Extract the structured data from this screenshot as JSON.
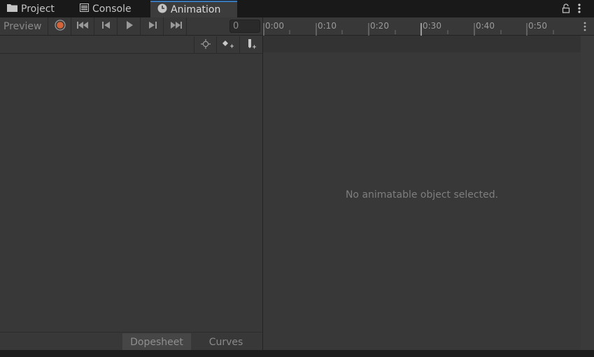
{
  "tabs": [
    {
      "label": "Project",
      "icon": "folder-icon"
    },
    {
      "label": "Console",
      "icon": "console-icon"
    },
    {
      "label": "Animation",
      "icon": "clock-icon"
    }
  ],
  "toolbar": {
    "preview_label": "Preview",
    "frame_value": "0"
  },
  "timeline": {
    "ticks": [
      "0:00",
      "0:10",
      "0:20",
      "0:30",
      "0:40",
      "0:50"
    ]
  },
  "views": {
    "dopesheet_label": "Dopesheet",
    "curves_label": "Curves"
  },
  "message": "No animatable object selected.",
  "colors": {
    "accent": "#3a79bb",
    "record": "#d4643a",
    "panel": "#383838"
  }
}
